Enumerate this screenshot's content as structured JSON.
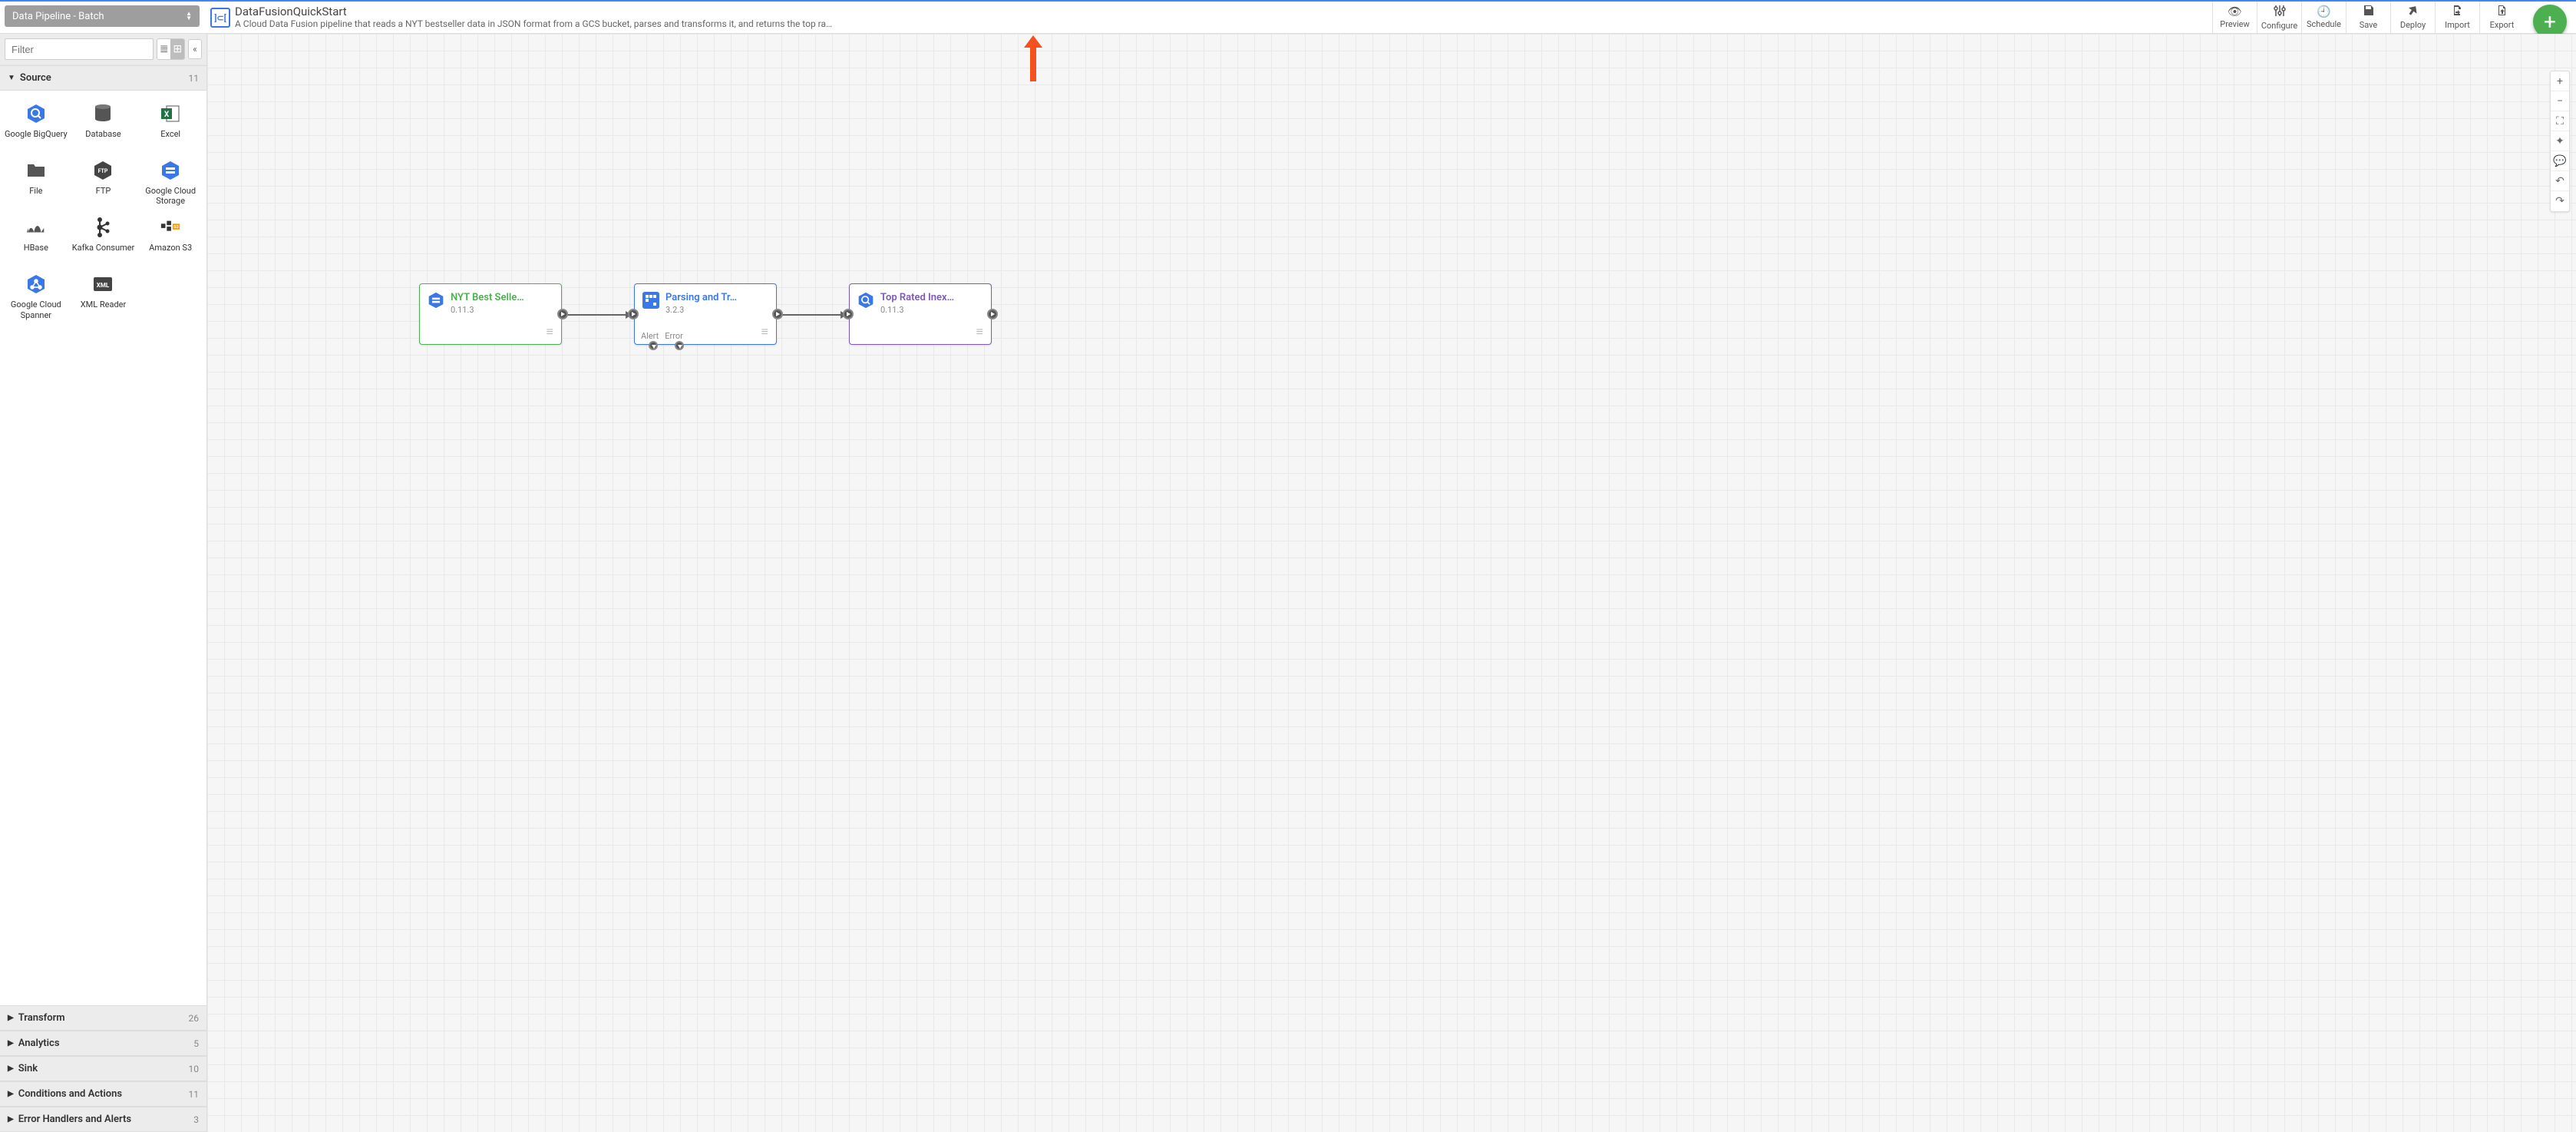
{
  "pipelineType": "Data Pipeline - Batch",
  "pipeline": {
    "name": "DataFusionQuickStart",
    "description": "A Cloud Data Fusion pipeline that reads a NYT bestseller data in JSON format from a GCS bucket, parses and transforms it, and returns the top rated book…"
  },
  "toolbar": {
    "preview": "Preview",
    "configure": "Configure",
    "schedule": "Schedule",
    "save": "Save",
    "deploy": "Deploy",
    "import": "Import",
    "export": "Export"
  },
  "filter": {
    "placeholder": "Filter"
  },
  "categories": {
    "source": {
      "label": "Source",
      "count": "11"
    },
    "transform": {
      "label": "Transform",
      "count": "26"
    },
    "analytics": {
      "label": "Analytics",
      "count": "5"
    },
    "sink": {
      "label": "Sink",
      "count": "10"
    },
    "conditions": {
      "label": "Conditions and Actions",
      "count": "11"
    },
    "errors": {
      "label": "Error Handlers and Alerts",
      "count": "3"
    }
  },
  "sourcePlugins": {
    "bigquery": "Google BigQuery",
    "database": "Database",
    "excel": "Excel",
    "file": "File",
    "ftp": "FTP",
    "gcs": "Google Cloud Storage",
    "hbase": "HBase",
    "kafka": "Kafka Consumer",
    "s3": "Amazon S3",
    "spanner": "Google Cloud Spanner",
    "xml": "XML Reader"
  },
  "nodes": {
    "n1": {
      "title": "NYT Best Selle…",
      "version": "0.11.3"
    },
    "n2": {
      "title": "Parsing and Tr…",
      "version": "3.2.3",
      "portAlert": "Alert",
      "portError": "Error"
    },
    "n3": {
      "title": "Top Rated Inex…",
      "version": "0.11.3"
    }
  },
  "colors": {
    "green": "#4caf50",
    "blue": "#3b78e7",
    "purple": "#7e57c2",
    "orange": "#f4511e"
  }
}
